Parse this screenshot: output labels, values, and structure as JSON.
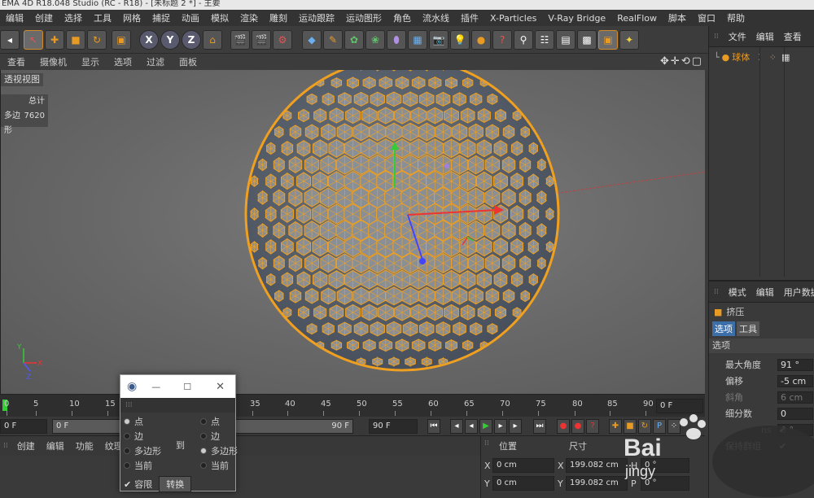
{
  "title": "EMA 4D R18.048 Studio (RC - R18) - [未标题 2 *] - 主要",
  "menu": [
    "编辑",
    "创建",
    "选择",
    "工具",
    "网格",
    "捕捉",
    "动画",
    "模拟",
    "渲染",
    "雕刻",
    "运动跟踪",
    "运动图形",
    "角色",
    "流水线",
    "插件",
    "X-Particles",
    "V-Ray Bridge",
    "RealFlow",
    "脚本",
    "窗口",
    "帮助"
  ],
  "toolbar": {
    "axis_x": "X",
    "axis_y": "Y",
    "axis_z": "Z"
  },
  "viewport_menu": [
    "查看",
    "摄像机",
    "显示",
    "选项",
    "过滤",
    "面板"
  ],
  "viewport": {
    "label": "透视视图",
    "stats_header": "总计",
    "stats_label": "多边形",
    "stats_value": "7620"
  },
  "object_manager": {
    "tabs": [
      "文件",
      "编辑",
      "查看"
    ],
    "object_name": "球体"
  },
  "attribute_manager": {
    "tabs": [
      "模式",
      "编辑",
      "用户数据"
    ],
    "tool_name": "挤压",
    "subtabs": [
      "选项",
      "工具"
    ],
    "section": "选项",
    "fields": [
      {
        "label": "最大角度",
        "value": "91 °"
      },
      {
        "label": "偏移",
        "value": "-5 cm"
      },
      {
        "label": "斜角",
        "value": "6 cm"
      },
      {
        "label": "细分数",
        "value": "0"
      },
      {
        "label": "",
        "value": "0 °"
      },
      {
        "label": "保持群组",
        "value": ""
      }
    ],
    "partial_label": "ns"
  },
  "timeline": {
    "ticks": [
      "0",
      "5",
      "10",
      "15",
      "35",
      "40",
      "45",
      "50",
      "55",
      "60",
      "65",
      "70",
      "75",
      "80",
      "85",
      "90"
    ],
    "end_frame": "0 F"
  },
  "frames": {
    "start": "0 F",
    "current": "0 F",
    "end": "90 F",
    "end2": "90 F"
  },
  "bottom_menu": [
    "创建",
    "编辑",
    "功能",
    "纹理"
  ],
  "coords": {
    "header_pos": "位置",
    "header_size": "尺寸",
    "x_label": "X",
    "x_pos": "0 cm",
    "x_size_label": "X",
    "x_size": "199.082 cm",
    "x_rot_label": "H",
    "x_rot": "0 °",
    "y_label": "Y",
    "y_pos": "0 cm",
    "y_size_label": "Y",
    "y_size": "199.082 cm",
    "y_rot_label": "P",
    "y_rot": "0 °"
  },
  "dialog": {
    "left_options": [
      "点",
      "边",
      "多边形",
      "当前"
    ],
    "to": "到",
    "right_options": [
      "点",
      "边",
      "多边形",
      "当前"
    ],
    "restrict": "容限",
    "convert": "转换"
  },
  "watermark": {
    "text": "Bai",
    "sub": "jingy"
  },
  "colors": {
    "accent": "#e79a24",
    "sphere_edge": "#f0a020",
    "sphere_face": "#5c6470"
  }
}
